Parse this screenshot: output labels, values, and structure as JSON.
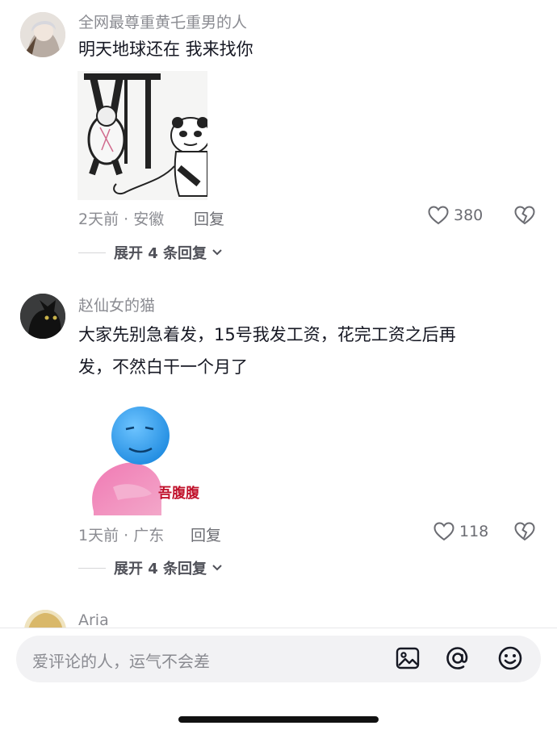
{
  "comments": [
    {
      "username": "全网最尊重黄乇重男的人",
      "text_lines": [
        "明天地球还在 我来找你"
      ],
      "meta": "2天前 · 安徽",
      "reply_label": "回复",
      "likes": "380",
      "expand_label": "展开 4 条回复"
    },
    {
      "username": "赵仙女的猫",
      "text_lines": [
        "大家先别急着发，15号我发工资，花完工资之后再",
        "发，不然白干一个月了"
      ],
      "meta": "1天前 · 广东",
      "reply_label": "回复",
      "likes": "118",
      "expand_label": "展开 4 条回复",
      "sticker_caption": "吾腹腹"
    },
    {
      "username": "Aria"
    }
  ],
  "input": {
    "placeholder": "爱评论的人，运气不会差"
  },
  "icons": {
    "like": "heart-outline-icon",
    "dislike": "broken-heart-icon",
    "expand": "chevron-down-icon",
    "image": "image-icon",
    "mention": "at-icon",
    "emoji": "smiley-icon"
  }
}
